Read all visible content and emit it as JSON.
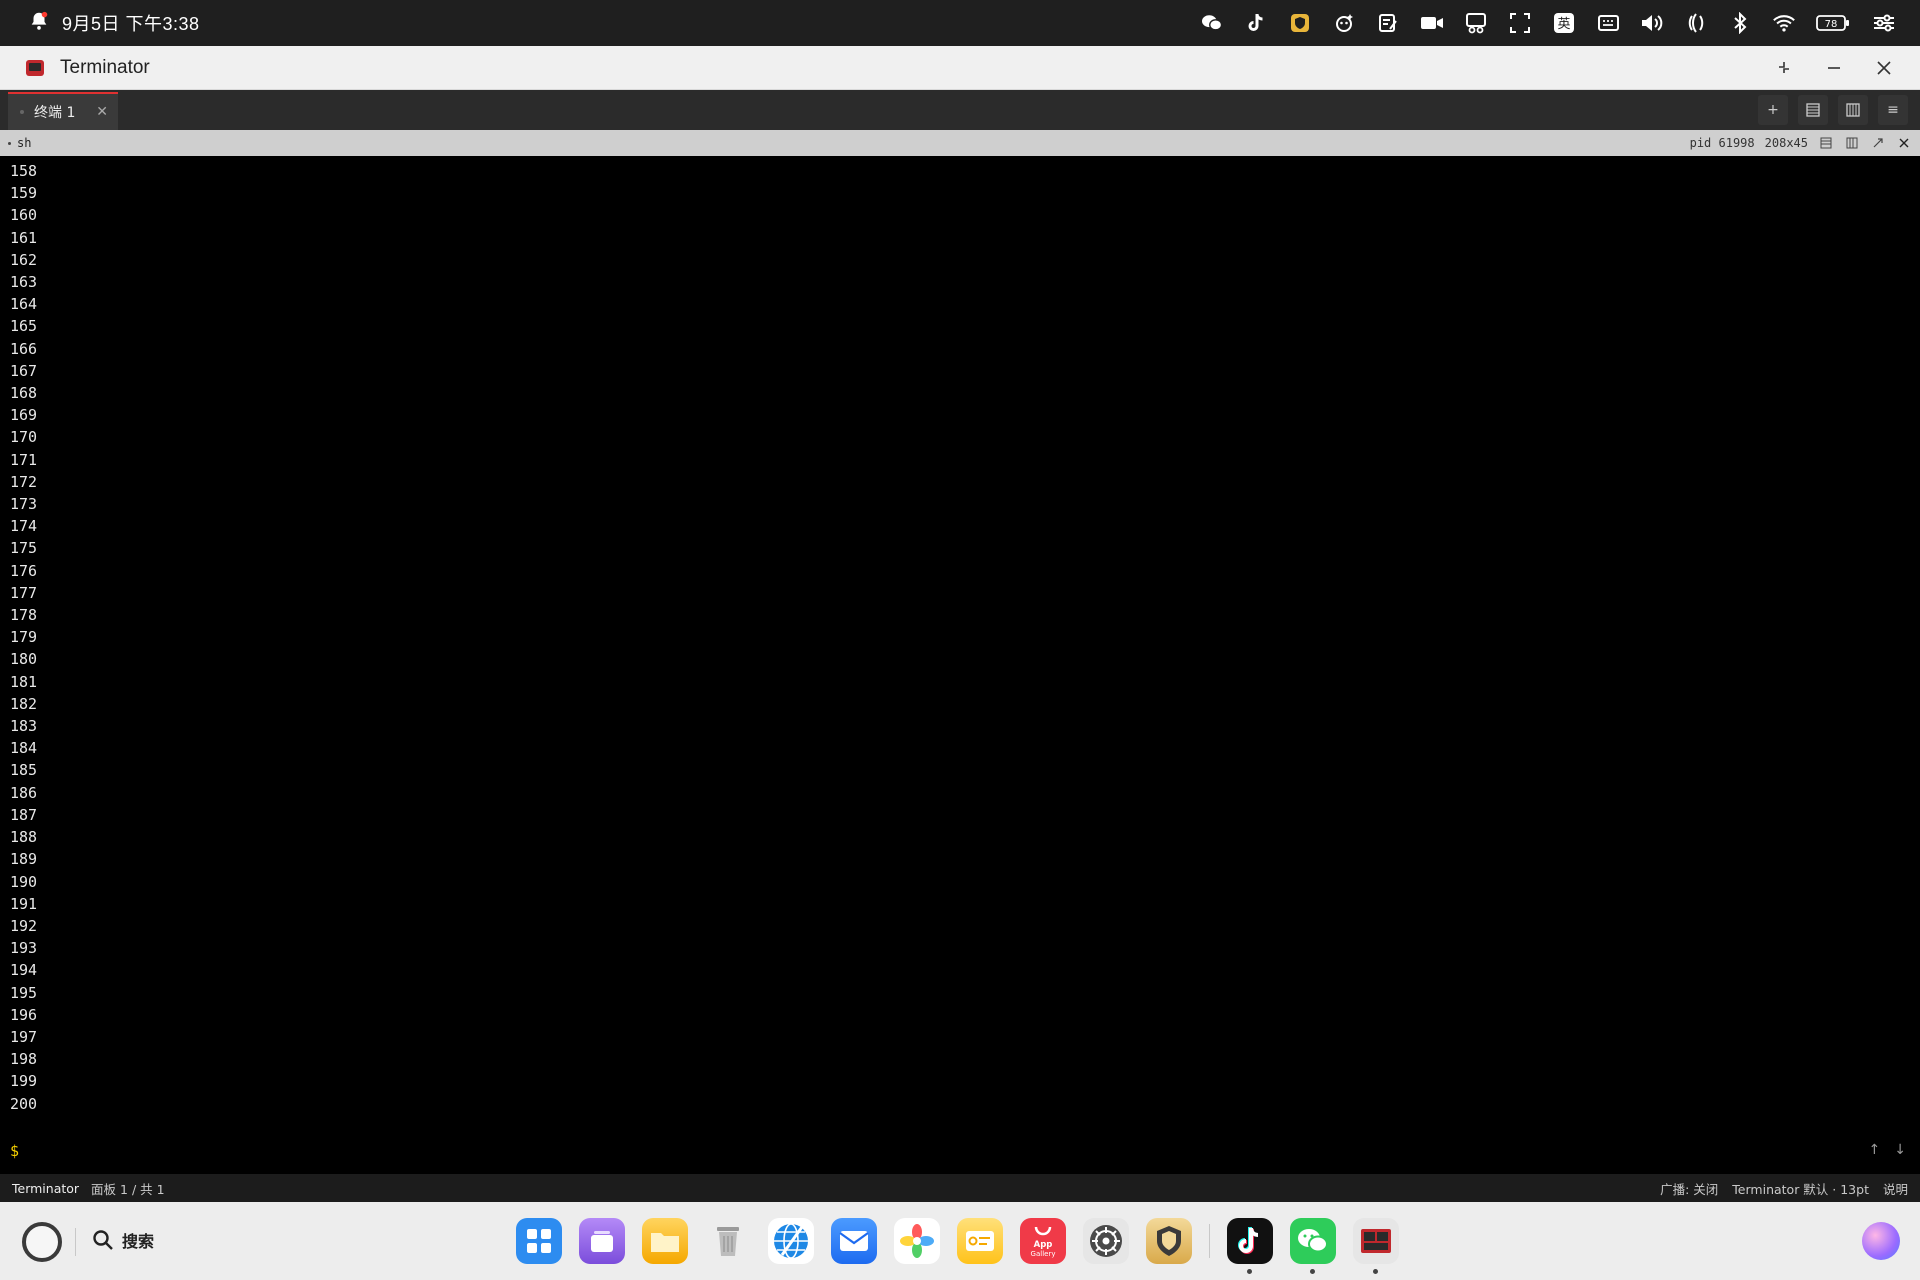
{
  "status_bar": {
    "time": "9月5日 下午3:38",
    "tray_icons": [
      "wechat-icon",
      "tiktok-icon",
      "shield-app-icon",
      "ai-assistant-icon",
      "notes-icon",
      "screen-record-icon",
      "screenshot-icon",
      "region-capture-icon",
      "input-method-icon",
      "keyboard-icon",
      "volume-icon",
      "nfc-icon",
      "bluetooth-icon",
      "wifi-icon",
      "battery-icon",
      "control-center-icon"
    ],
    "input_method": "英",
    "battery": "78"
  },
  "window": {
    "title": "Terminator"
  },
  "tabs": [
    {
      "label": "终端 1",
      "active": true
    }
  ],
  "pane": {
    "name": "sh",
    "pid": "pid 61998",
    "size": "208x45"
  },
  "terminal": {
    "lines": [
      "158",
      "159",
      "160",
      "161",
      "162",
      "163",
      "164",
      "165",
      "166",
      "167",
      "168",
      "169",
      "170",
      "171",
      "172",
      "173",
      "174",
      "175",
      "176",
      "177",
      "178",
      "179",
      "180",
      "181",
      "182",
      "183",
      "184",
      "185",
      "186",
      "187",
      "188",
      "189",
      "190",
      "191",
      "192",
      "193",
      "194",
      "195",
      "196",
      "197",
      "198",
      "199",
      "200"
    ],
    "prompt": "$",
    "scroll_up": "↑",
    "scroll_down": "↓"
  },
  "window_status": {
    "app": "Terminator",
    "pane_info": "面板 1 / 共 1",
    "broadcast": "广播: 关闭",
    "profile": "Terminator 默认 · 13pt",
    "help": "说明"
  },
  "dock": {
    "search_label": "搜索",
    "apps": [
      {
        "name": "launcher",
        "color": "#2d8cf0"
      },
      {
        "name": "multitask",
        "color": "#9d6bf0"
      },
      {
        "name": "files",
        "color": "#ffc533"
      },
      {
        "name": "trash",
        "color": "#c9c9c9"
      },
      {
        "name": "browser",
        "color": "#1e88e5"
      },
      {
        "name": "mail",
        "color": "#2979ff"
      },
      {
        "name": "gallery",
        "color": "#ffffff"
      },
      {
        "name": "notes",
        "color": "#ffcc33"
      },
      {
        "name": "app-gallery",
        "color": "#f03a48",
        "label": "App Gallery"
      },
      {
        "name": "settings",
        "color": "#4a4a4a"
      },
      {
        "name": "security",
        "color": "#e6c47a"
      },
      {
        "name": "tiktok",
        "color": "#111111",
        "running": true
      },
      {
        "name": "wechat",
        "color": "#2ecc5a",
        "running": true
      },
      {
        "name": "terminator",
        "color": "#e0e0e0",
        "running": true
      }
    ]
  }
}
